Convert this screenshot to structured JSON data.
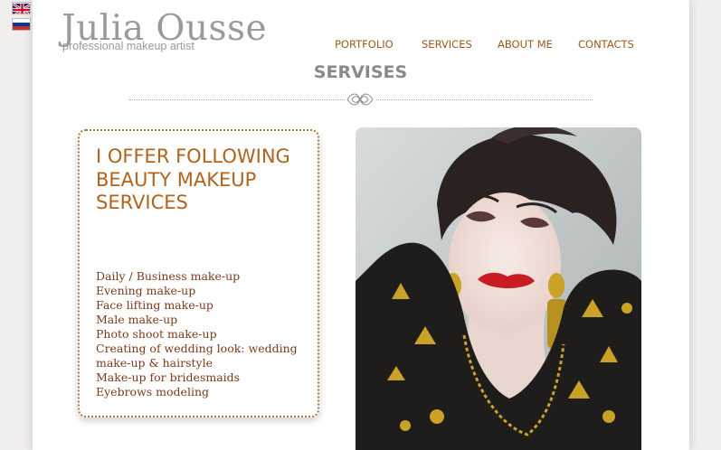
{
  "logo": {
    "name": "Julia Ousse",
    "tagline": "professional makeup artist"
  },
  "languages": [
    {
      "code": "en",
      "icon": "uk-flag-icon"
    },
    {
      "code": "ru",
      "icon": "russia-flag-icon"
    }
  ],
  "nav": {
    "items": [
      {
        "label": "PORTFOLIO"
      },
      {
        "label": "SERVICES"
      },
      {
        "label": "ABOUT ME"
      },
      {
        "label": "CONTACTS"
      }
    ]
  },
  "page_title": "SERVISES",
  "services": {
    "heading": "I OFFER FOLLOWING BEAUTY MAKEUP SERVICES",
    "items": [
      "Daily / Business make-up",
      "Evening make-up",
      "Face lifting make-up",
      "Male make-up",
      "Photo shoot make-up",
      "Creating of wedding look: wedding make-up & hairstyle",
      "Make-up for bridesmaids",
      "Eyebrows modeling"
    ]
  },
  "colors": {
    "accent": "#b1631c",
    "nav_text": "#9a5a1c",
    "list_text": "#7a3a1a",
    "logo_gray": "#9a9a9a",
    "title_gray": "#8a8a8a",
    "border_dotted": "#b07a3e",
    "page_background": "#f1eeee"
  }
}
